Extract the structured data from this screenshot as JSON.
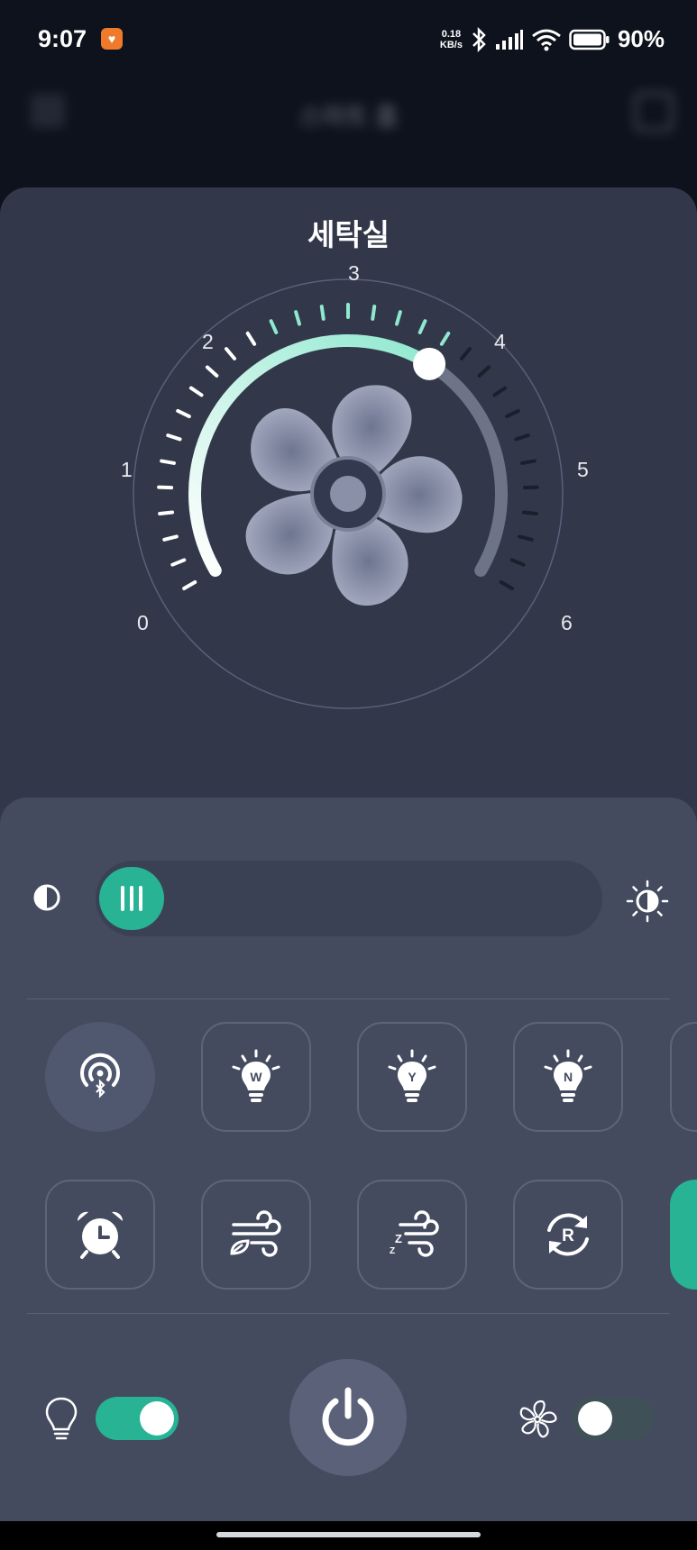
{
  "status_bar": {
    "time": "9:07",
    "net_speed_value": "0.18",
    "net_speed_unit": "KB/s",
    "battery_percent": "90%",
    "icons": [
      "app-notification-icon",
      "bluetooth-icon",
      "signal-icon",
      "wifi-icon",
      "battery-icon"
    ]
  },
  "background_header": {
    "title": "스마트 홈",
    "icons": [
      "menu-icon",
      "home-icon"
    ]
  },
  "room": {
    "title": "세탁실"
  },
  "fan_dial": {
    "scale_labels": [
      "0",
      "1",
      "2",
      "3",
      "4",
      "5",
      "6"
    ],
    "speed_level": 3.8,
    "speed_max": 6,
    "colors": {
      "active_arc": "#9ff0d9",
      "inactive_arc": "#6d7488",
      "accent": "#27b394"
    }
  },
  "brightness_slider": {
    "value_fraction": 0.02,
    "left_icon": "contrast-icon",
    "right_icon": "brightness-icon"
  },
  "mode_buttons_row1": [
    {
      "name": "bluetooth-scan-icon"
    },
    {
      "name": "bulb-w-icon",
      "letter": "W"
    },
    {
      "name": "bulb-y-icon",
      "letter": "Y"
    },
    {
      "name": "bulb-n-icon",
      "letter": "N"
    }
  ],
  "mode_buttons_row2": [
    {
      "name": "alarm-clock-icon"
    },
    {
      "name": "natural-wind-icon"
    },
    {
      "name": "sleep-wind-icon"
    },
    {
      "name": "rotate-icon",
      "letter": "R"
    }
  ],
  "bottom_controls": {
    "light_toggle_on": true,
    "fan_toggle_on": false,
    "icons": [
      "light-bulb-icon",
      "power-icon",
      "fan-icon"
    ]
  }
}
